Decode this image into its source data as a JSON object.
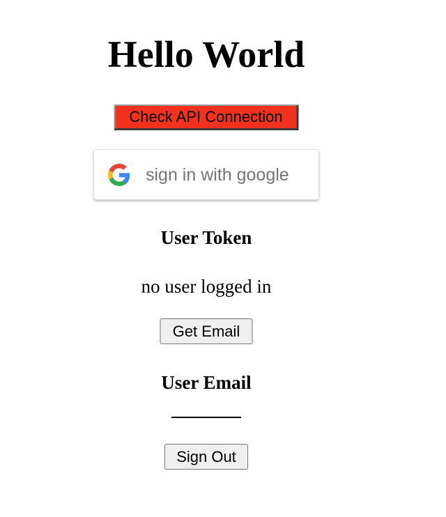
{
  "header": {
    "title": "Hello World"
  },
  "api": {
    "check_label": "Check API Connection",
    "button_color": "#f2321f"
  },
  "google": {
    "label": "sign in with google",
    "icon": "google-g-logo-icon",
    "label_color": "#757575"
  },
  "token": {
    "heading": "User Token",
    "status": "no user logged in"
  },
  "email": {
    "get_label": "Get Email",
    "heading": "User Email",
    "value": ""
  },
  "auth": {
    "sign_out_label": "Sign Out"
  }
}
